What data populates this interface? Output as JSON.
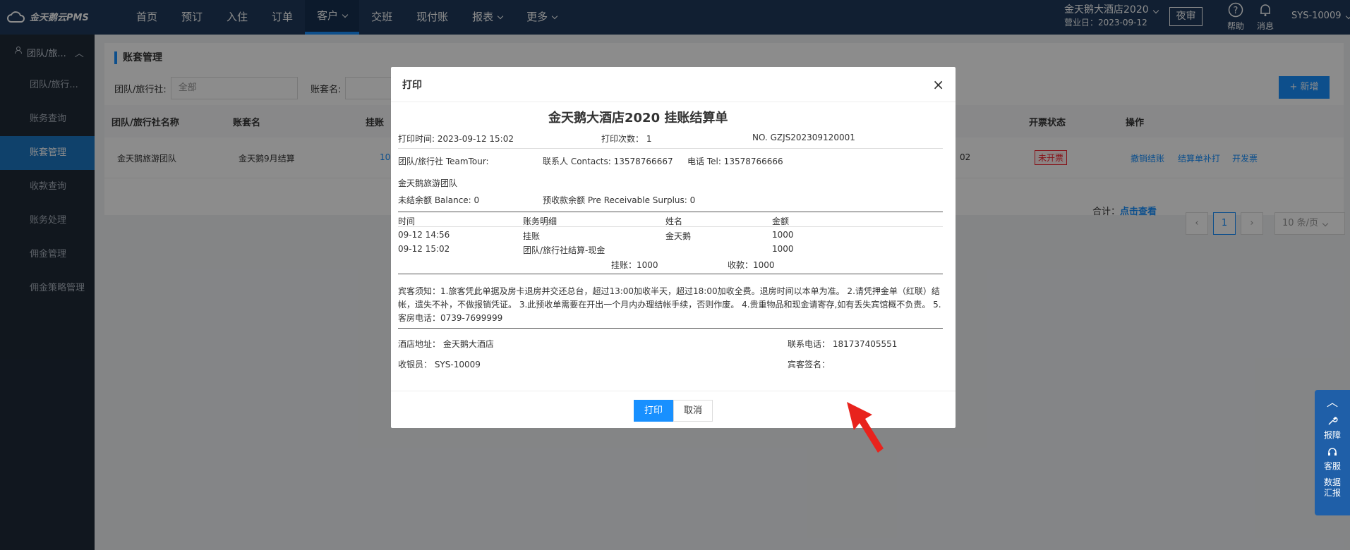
{
  "app": {
    "logo": "金天鹅云PMS"
  },
  "nav": [
    {
      "label": "首页"
    },
    {
      "label": "预订"
    },
    {
      "label": "入住"
    },
    {
      "label": "订单"
    },
    {
      "label": "客户",
      "active": true,
      "dropdown": true
    },
    {
      "label": "交班"
    },
    {
      "label": "现付账"
    },
    {
      "label": "报表",
      "dropdown": true
    },
    {
      "label": "更多",
      "dropdown": true
    }
  ],
  "header": {
    "hotel": "金天鹅大酒店2020",
    "business_day": "营业日：2023-09-12",
    "night_audit": "夜审",
    "help": "帮助",
    "messages": "消息",
    "user": "SYS-10009"
  },
  "sidebar": {
    "group": "团队/旅...",
    "items": [
      "团队/旅行...",
      "账务查询",
      "账套管理",
      "收款查询",
      "账务处理",
      "佣金管理",
      "佣金策略管理"
    ],
    "active_index": 2
  },
  "page": {
    "title": "账套管理",
    "filter_team_label": "团队/旅行社:",
    "filter_team_value": "全部",
    "filter_name_label": "账套名:",
    "add_button": "+ 新增"
  },
  "table": {
    "headers": [
      "团队/旅行社名称",
      "账套名",
      "挂账",
      "开票状态",
      "操作"
    ],
    "row": {
      "team": "金天鹅旅游团队",
      "name": "金天鹅9月结算",
      "amount": "10",
      "date_tail": "02",
      "invoice": "未开票",
      "actions": [
        "撤销结账",
        "结算单补打",
        "开发票"
      ]
    }
  },
  "pager": {
    "total_label": "合计：",
    "total_link": "点击查看",
    "page": "1",
    "page_size": "10 条/页"
  },
  "modal": {
    "title": "打印",
    "close": "×",
    "print": "打印",
    "cancel": "取消"
  },
  "bill": {
    "heading": "金天鹅大酒店2020 挂账结算单",
    "print_time": "打印时间: 2023-09-12 15:02",
    "print_count": "打印次数：  1",
    "number": "NO. GZJS202309120001",
    "team_label": "团队/旅行社 TeamTour:",
    "contact": "联系人 Contacts:  13578766667",
    "tel": "电话 Tel:  13578766666",
    "team_name": "金天鹅旅游团队",
    "balance": "未结余额 Balance:   0",
    "surplus": "预收款余额 Pre Receivable Surplus:   0",
    "cols": [
      "时间",
      "账务明细",
      "姓名",
      "金额"
    ],
    "rows": [
      [
        "09-12 14:56",
        "挂账",
        "金天鹅",
        "1000"
      ],
      [
        "09-12 15:02",
        "团队/旅行社结算-现金",
        "",
        "1000"
      ]
    ],
    "sum_credit": "挂账：1000",
    "sum_received": "收款：1000",
    "notice": "宾客须知：1.旅客凭此单据及房卡退房并交还总台，超过13:00加收半天，超过18:00加收全费。退房时间以本单为准。 2.请凭押金单（红联）结帐，遗失不补，不做报销凭证。 3.此预收单需要在开出一个月内办理结帐手续，否则作废。 4.贵重物品和现金请寄存,如有丢失宾馆概不负责。 5.客房电话：0739-7699999",
    "address": "酒店地址：  金天鹅大酒店",
    "phone": "联系电话：  181737405551",
    "cashier": "收银员：  SYS-10009",
    "guest_sign": "宾客签名："
  },
  "float": {
    "items": [
      "报障",
      "客服",
      "数据汇报"
    ]
  },
  "colors": {
    "topbar": "#1f3a5c",
    "primary": "#1890ff",
    "sidebar": "#1f2a38",
    "active": "#1d77c4",
    "danger": "#f5222d"
  }
}
